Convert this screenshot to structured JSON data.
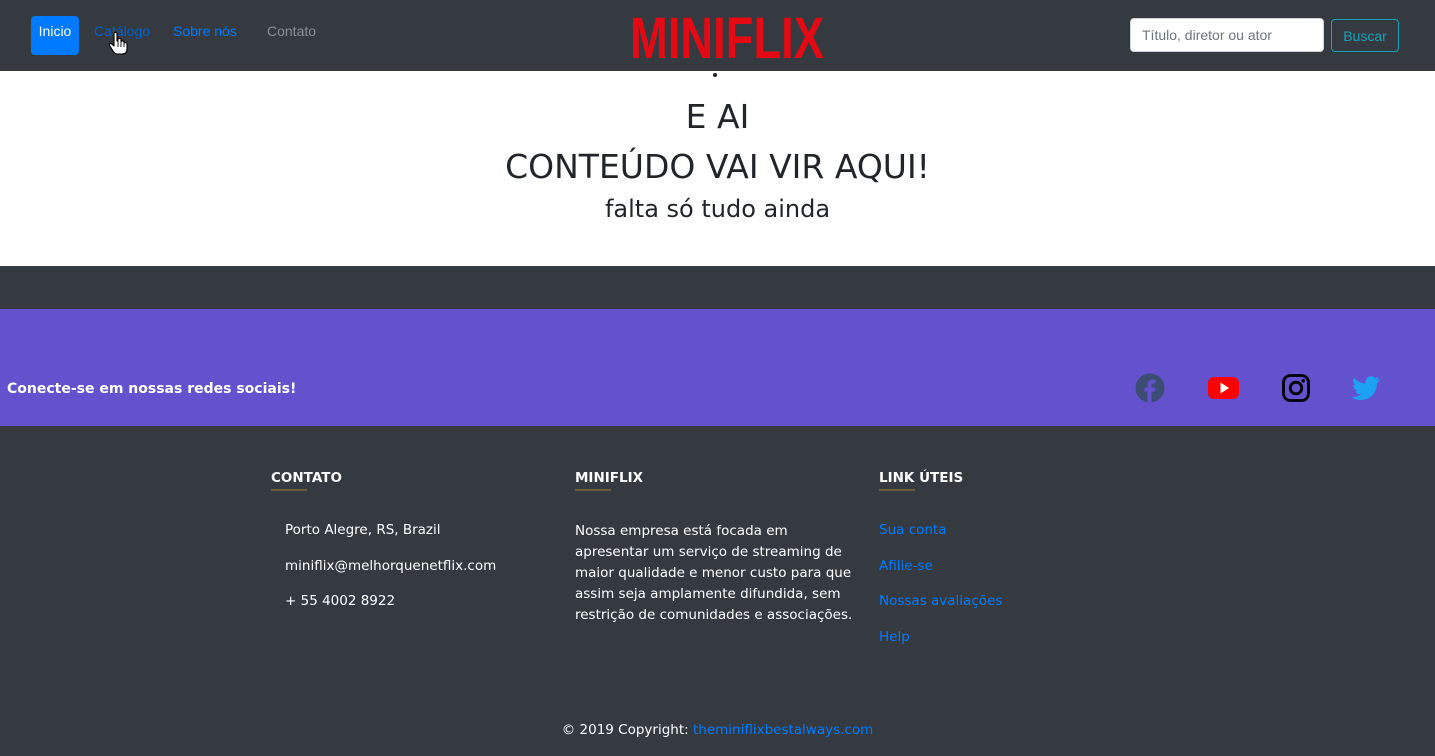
{
  "navbar": {
    "links": [
      {
        "label": "Inicio"
      },
      {
        "label": "Catálogo"
      },
      {
        "label": "Sobre nós"
      },
      {
        "label": "Contato"
      }
    ],
    "logo": "MINIFLIX",
    "search": {
      "placeholder": "Título, diretor ou ator",
      "value": ""
    },
    "search_button": "Buscar"
  },
  "hero": {
    "line1": "E AI",
    "line2": "CONTEÚDO VAI VIR AQUI!",
    "line3": "falta só tudo ainda"
  },
  "social": {
    "text": "Conecte-se em nossas redes sociais!",
    "icons": [
      "facebook-icon",
      "youtube-icon",
      "instagram-icon",
      "twitter-icon"
    ]
  },
  "footer": {
    "contato": {
      "title": "CONTATO",
      "address": "Porto Alegre, RS, Brazil",
      "email": "miniflix@melhorquenetflix.com",
      "phone": "+ 55 4002 8922"
    },
    "miniflix": {
      "title": "MINIFLIX",
      "description": "Nossa empresa está focada em apresentar um serviço de streaming de maior qualidade e menor custo para que assim seja amplamente difundida, sem restrição de comunidades e associações."
    },
    "links": {
      "title": "LINK ÚTEIS",
      "items": [
        "Sua conta",
        "Afilie-se",
        "Nossas avaliações",
        "Help"
      ]
    },
    "copyright": {
      "prefix": "© 2019 Copyright: ",
      "link": "theminiflixbestalways.com"
    }
  },
  "colors": {
    "navbar_bg": "#343a40",
    "primary": "#007bff",
    "info": "#17a2b8",
    "logo_red": "#e50914",
    "social_bg": "#6351ce",
    "footer_bg": "#343a40"
  }
}
